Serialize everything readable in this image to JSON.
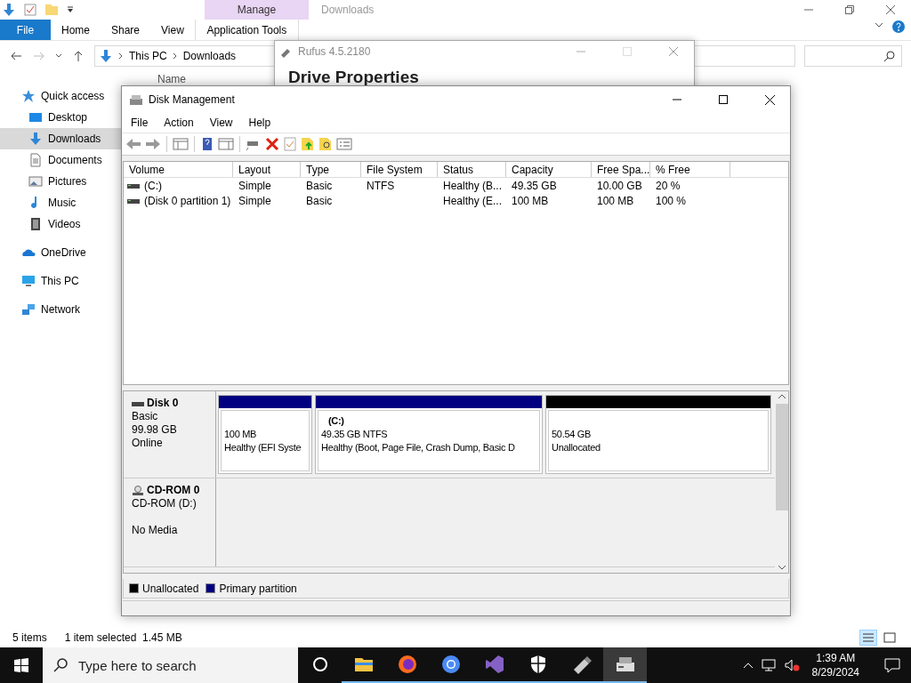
{
  "explorer": {
    "title": "Downloads",
    "context_tab": "Manage",
    "ribbon_tabs": [
      {
        "label": "File",
        "kind": "file",
        "selected": false
      },
      {
        "label": "Home",
        "kind": "tab",
        "selected": false
      },
      {
        "label": "Share",
        "kind": "tab",
        "selected": false
      },
      {
        "label": "View",
        "kind": "tab",
        "selected": false
      },
      {
        "label": "Application Tools",
        "kind": "context",
        "selected": false
      }
    ],
    "breadcrumb": [
      "This PC",
      "Downloads"
    ],
    "column_header": "Name",
    "nav_pane": [
      {
        "label": "Quick access",
        "kind": "star",
        "group": true,
        "selected": false
      },
      {
        "label": "Desktop",
        "kind": "desktop",
        "group": false,
        "selected": false
      },
      {
        "label": "Downloads",
        "kind": "download",
        "group": false,
        "selected": true
      },
      {
        "label": "Documents",
        "kind": "document",
        "group": false,
        "selected": false
      },
      {
        "label": "Pictures",
        "kind": "pictures",
        "group": false,
        "selected": false
      },
      {
        "label": "Music",
        "kind": "music",
        "group": false,
        "selected": false
      },
      {
        "label": "Videos",
        "kind": "videos",
        "group": false,
        "selected": false
      },
      {
        "label": "OneDrive",
        "kind": "cloud",
        "group": true,
        "selected": false
      },
      {
        "label": "This PC",
        "kind": "pc",
        "group": true,
        "selected": false
      },
      {
        "label": "Network",
        "kind": "network",
        "group": true,
        "selected": false
      }
    ],
    "status_bar": {
      "count": "5 items",
      "selection": "1 item selected  1.45 MB"
    }
  },
  "rufus": {
    "title": "Rufus 4.5.2180",
    "heading": "Drive Properties"
  },
  "disk_management": {
    "title": "Disk Management",
    "menu": [
      "File",
      "Action",
      "View",
      "Help"
    ],
    "table": {
      "columns": [
        "Volume",
        "Layout",
        "Type",
        "File System",
        "Status",
        "Capacity",
        "Free Spa...",
        "% Free"
      ],
      "rows": [
        [
          "(C:)",
          "Simple",
          "Basic",
          "NTFS",
          "Healthy (B...",
          "49.35 GB",
          "10.00 GB",
          "20 %"
        ],
        [
          "(Disk 0 partition 1)",
          "Simple",
          "Basic",
          "",
          "Healthy (E...",
          "100 MB",
          "100 MB",
          "100 %"
        ]
      ]
    },
    "disks": [
      {
        "kind": "disk",
        "name": "Disk 0",
        "lines": [
          "Basic",
          "99.98 GB",
          "Online"
        ],
        "partitions": [
          {
            "color": "#000080",
            "lines": [
              "100 MB",
              "Healthy (EFI Syste"
            ]
          },
          {
            "color": "#000080",
            "name": "(C:)",
            "lines": [
              "49.35 GB NTFS",
              "Healthy (Boot, Page File, Crash Dump, Basic D"
            ]
          },
          {
            "color": "#000000",
            "lines": [
              "50.54 GB",
              "Unallocated"
            ]
          }
        ]
      },
      {
        "kind": "cdrom",
        "name": "CD-ROM 0",
        "lines": [
          "CD-ROM (D:)",
          "No Media"
        ]
      }
    ],
    "legend": [
      {
        "label": "Unallocated",
        "color": "#000000"
      },
      {
        "label": "Primary partition",
        "color": "#000080"
      }
    ]
  },
  "taskbar": {
    "search_placeholder": "Type here to search",
    "apps": [
      {
        "kind": "cortana",
        "running": false,
        "selected": false
      },
      {
        "kind": "folder",
        "running": true,
        "selected": false
      },
      {
        "kind": "firefox",
        "running": true,
        "selected": false
      },
      {
        "kind": "chrome",
        "running": true,
        "selected": false
      },
      {
        "kind": "studio",
        "running": true,
        "selected": false
      },
      {
        "kind": "shield",
        "running": true,
        "selected": false
      },
      {
        "kind": "usb",
        "running": true,
        "selected": false
      },
      {
        "kind": "diskmgmt",
        "running": true,
        "selected": true
      }
    ],
    "time": "1:39 AM",
    "date": "8/29/2024"
  }
}
